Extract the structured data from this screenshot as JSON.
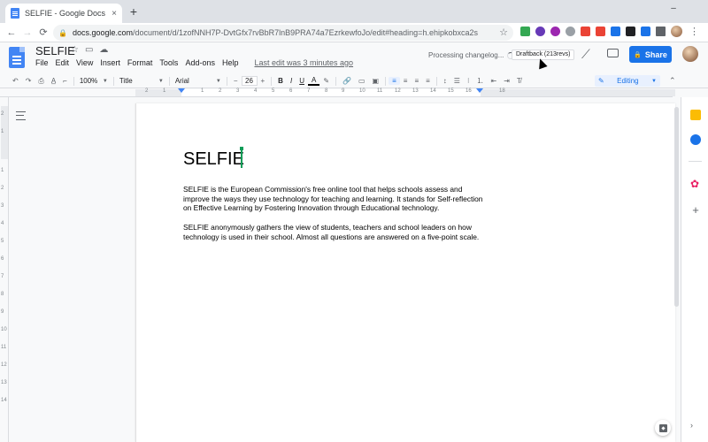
{
  "browser": {
    "tab_title": "SELFIE - Google Docs",
    "tab_close": "×",
    "new_tab": "+",
    "minimize": "–",
    "url_host": "docs.google.com",
    "url_path": "/document/d/1zofNNH7P-DvtGfx7rvBbR7lnB9PRA74a7EzrkewfoJo/edit#heading=h.ehipkobxca2s",
    "back": "←",
    "forward": "→",
    "reload": "⟳",
    "star": "☆",
    "extensions": [
      "#34a853",
      "#673ab7",
      "#9c27b0",
      "#5f6368",
      "#ea4335",
      "#ea4335",
      "#1a73e8",
      "#202124",
      "#1a73e8",
      "#5f6368",
      "#5f6368"
    ],
    "menu": "⋮"
  },
  "docs": {
    "title": "SELFIE",
    "menus": [
      "File",
      "Edit",
      "View",
      "Insert",
      "Format",
      "Tools",
      "Add-ons",
      "Help"
    ],
    "last_edit": "Last edit was 3 minutes ago",
    "processing": "Processing changelog...",
    "draftback": "Draftback (213revs)",
    "share": "Share",
    "share_lock": "🔒"
  },
  "toolbar": {
    "undo": "↶",
    "redo": "↷",
    "print": "⎙",
    "spell": "A̲",
    "paint": "⌐",
    "zoom": "100%",
    "style": "Title",
    "font": "Arial",
    "minus": "−",
    "font_size": "26",
    "plus": "+",
    "bold": "B",
    "italic": "I",
    "underline": "U",
    "text_color": "A",
    "highlight": "✎",
    "link": "🔗",
    "comment": "▭",
    "image": "▣",
    "align_left": "≡",
    "align_center": "≡",
    "align_right": "≡",
    "justify": "≡",
    "line_spacing": "↕",
    "checklist": "☰",
    "bullets": "⁝",
    "numbered": "⒈",
    "indent_less": "⇤",
    "indent_more": "⇥",
    "clear": "T̸",
    "editing": "Editing",
    "editing_icon": "✎",
    "collapse": "⌃"
  },
  "ruler": {
    "h_numbers": [
      "2",
      "1",
      "1",
      "2",
      "3",
      "4",
      "5",
      "6",
      "7",
      "8",
      "9",
      "10",
      "11",
      "12",
      "13",
      "14",
      "15",
      "16",
      "17",
      "18"
    ],
    "v_numbers": [
      "2",
      "1",
      "1",
      "2",
      "3",
      "4",
      "5",
      "6",
      "7",
      "8",
      "9",
      "10",
      "11",
      "12",
      "13",
      "14",
      "15",
      "16",
      "17",
      "18"
    ]
  },
  "document": {
    "heading": "SELFIE",
    "paragraph1": "SELFIE is the European Commission's free online tool that helps schools assess and improve the ways they use technology for teaching and learning. It stands for Self-reflection on Effective Learning by Fostering Innovation through Educational technology.",
    "paragraph2": "SELFIE anonymously gathers the view of students, teachers and school leaders on how technology is used in their school. Almost all questions are answered on a five-point scale."
  },
  "sidepanel": {
    "plus": "+",
    "collapse": "›"
  }
}
